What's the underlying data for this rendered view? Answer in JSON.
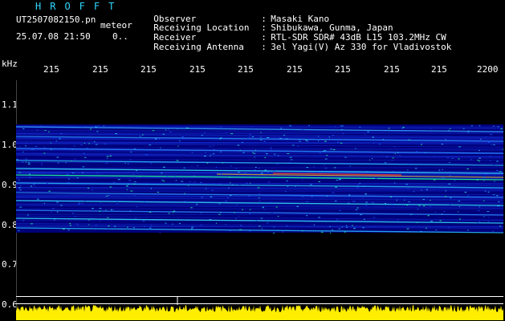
{
  "app_title": "HROFFT",
  "file": {
    "name": "UT2507082150.pn",
    "type": "meteor",
    "datetime": "25.07.08 21:50",
    "extra": "0.."
  },
  "header": {
    "observer_label": "Observer",
    "observer_value": "Masaki Kano",
    "location_label": "Receiving Location",
    "location_value": "Shibukawa, Gunma, Japan",
    "receiver_label": "Receiver",
    "receiver_value": "RTL-SDR SDR# 43dB L15 103.2MHz CW",
    "antenna_label": "Receiving Antenna",
    "antenna_value": "3el Yagi(V) Az 330 for Vladivostok",
    "colon": ":"
  },
  "axis": {
    "y_unit": "kHz",
    "y_ticks": [
      "1.1",
      "1.0",
      "0.9",
      "0.8",
      "0.7",
      "0.6"
    ],
    "x_ticks": [
      "215",
      "215",
      "215",
      "215",
      "215",
      "215",
      "215",
      "215",
      "215",
      "2200"
    ]
  },
  "colors": {
    "background": "#000000",
    "spectrogram_base": "#00007a",
    "accent_cyan": "#2fd6ff",
    "signal_yellow": "#ffee00"
  }
}
